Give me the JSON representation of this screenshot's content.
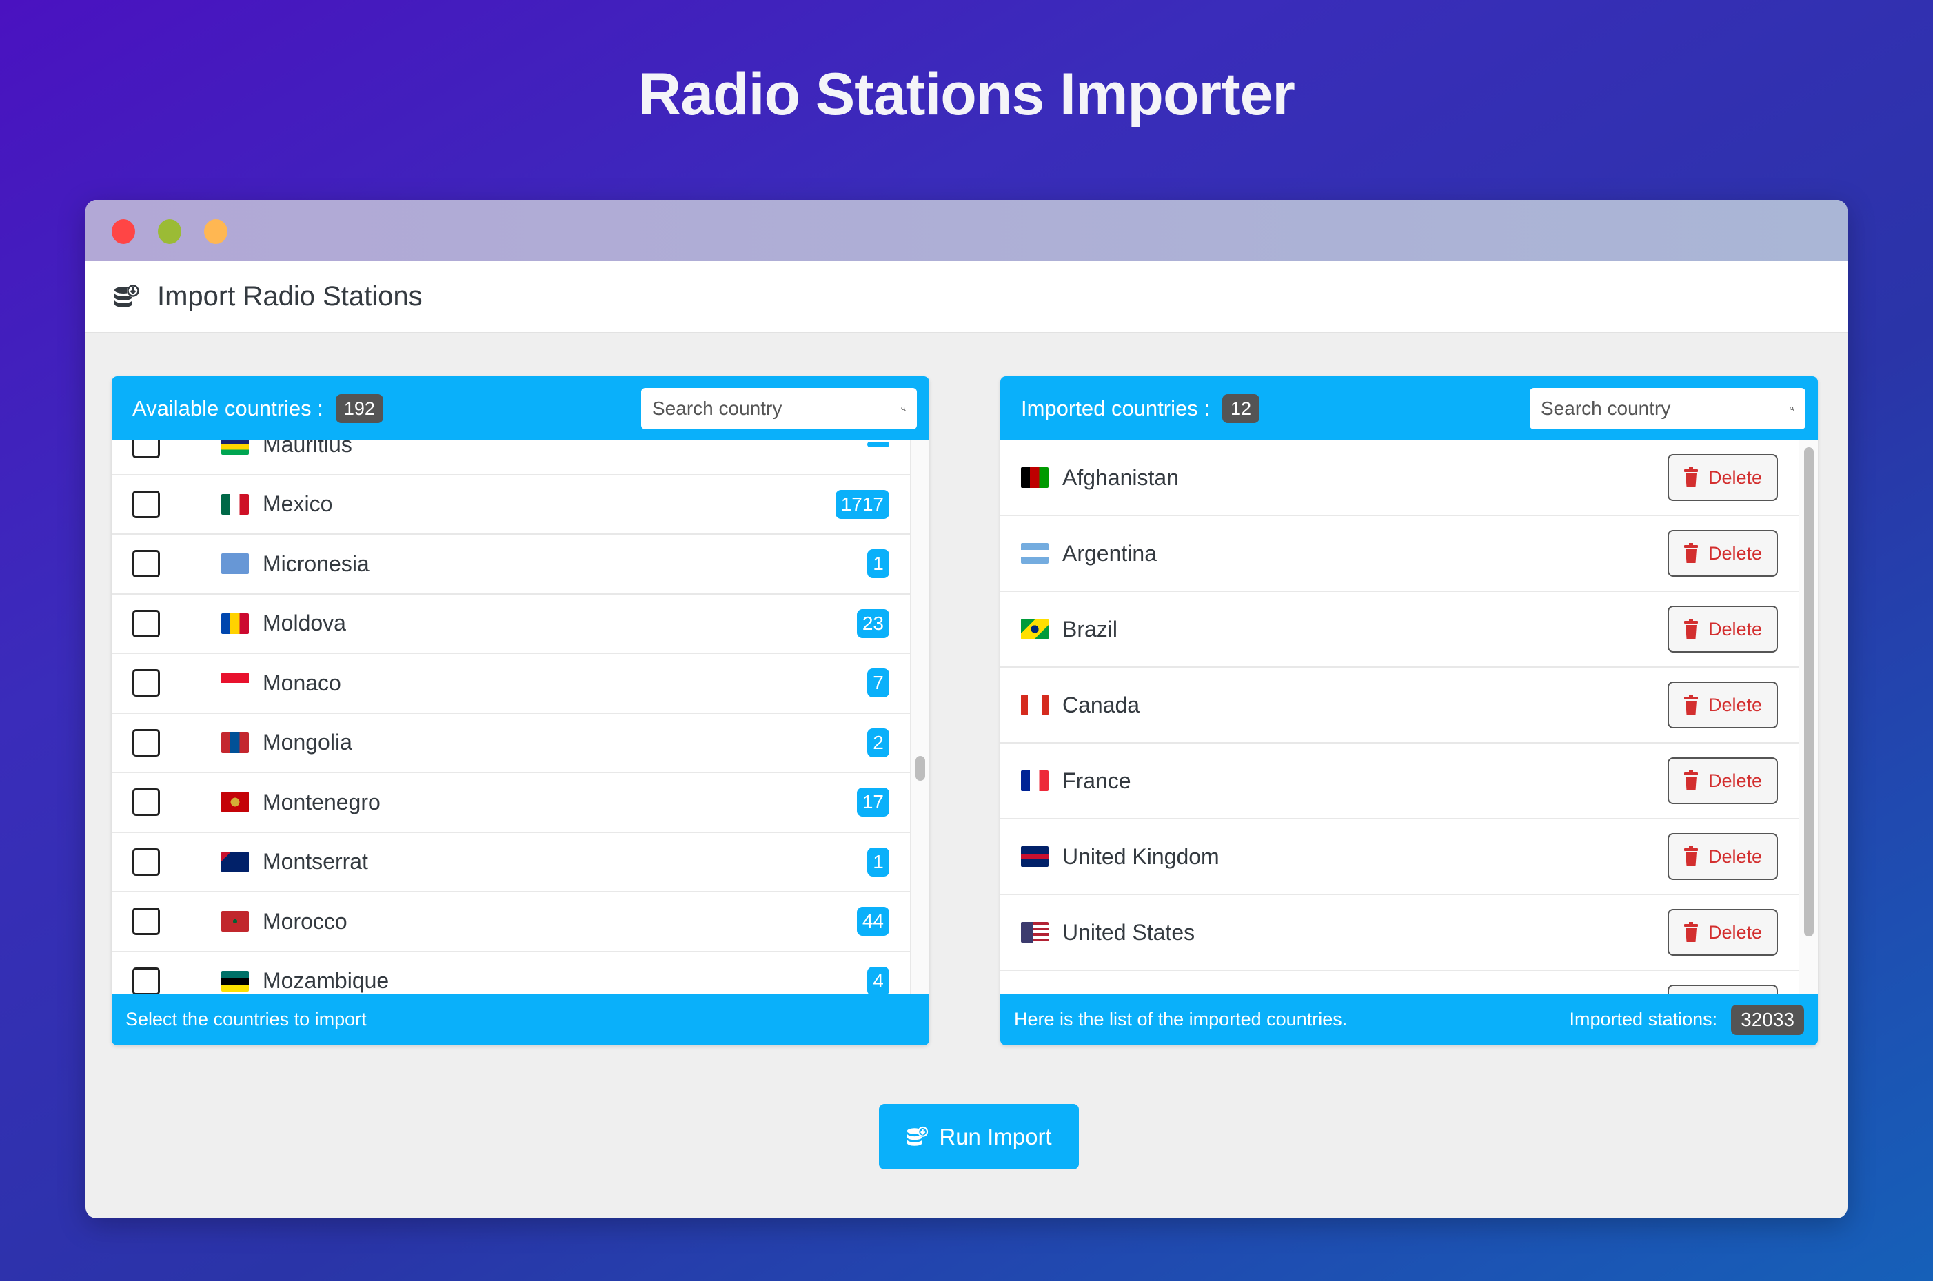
{
  "page": {
    "title": "Radio Stations Importer"
  },
  "window": {
    "controls": [
      "close",
      "minimize",
      "maximize"
    ],
    "colors": {
      "close": "#ff4545",
      "minimize": "#9bbb35",
      "maximize": "#ffb752"
    }
  },
  "header": {
    "icon": "database-download-icon",
    "title": "Import Radio Stations"
  },
  "available": {
    "label": "Available countries :",
    "count": "192",
    "search_placeholder": "Search country",
    "footer": "Select the countries to import",
    "countries": [
      {
        "name": "Mauritius",
        "stations": "",
        "flag": "mu",
        "checked": false
      },
      {
        "name": "Mexico",
        "stations": "1717",
        "flag": "mx",
        "checked": false
      },
      {
        "name": "Micronesia",
        "stations": "1",
        "flag": "fm",
        "checked": false
      },
      {
        "name": "Moldova",
        "stations": "23",
        "flag": "md",
        "checked": false
      },
      {
        "name": "Monaco",
        "stations": "7",
        "flag": "mc",
        "checked": false
      },
      {
        "name": "Mongolia",
        "stations": "2",
        "flag": "mn",
        "checked": false
      },
      {
        "name": "Montenegro",
        "stations": "17",
        "flag": "me",
        "checked": false
      },
      {
        "name": "Montserrat",
        "stations": "1",
        "flag": "ms",
        "checked": false
      },
      {
        "name": "Morocco",
        "stations": "44",
        "flag": "ma",
        "checked": false
      },
      {
        "name": "Mozambique",
        "stations": "4",
        "flag": "mz",
        "checked": false
      }
    ]
  },
  "imported": {
    "label": "Imported countries :",
    "count": "12",
    "search_placeholder": "Search country",
    "footer": "Here is the list of the imported countries.",
    "stations_label": "Imported stations:",
    "stations_total": "32033",
    "delete_label": "Delete",
    "countries": [
      {
        "name": "Afghanistan",
        "flag": "af"
      },
      {
        "name": "Argentina",
        "flag": "ar"
      },
      {
        "name": "Brazil",
        "flag": "br"
      },
      {
        "name": "Canada",
        "flag": "ca"
      },
      {
        "name": "France",
        "flag": "fr"
      },
      {
        "name": "United Kingdom",
        "flag": "gb"
      },
      {
        "name": "United States",
        "flag": "us"
      },
      {
        "name": "",
        "flag": ""
      }
    ]
  },
  "actions": {
    "run_import": "Run Import"
  },
  "colors": {
    "accent": "#0ab0fa",
    "badge_dark": "#545454",
    "danger": "#d32f2f"
  }
}
